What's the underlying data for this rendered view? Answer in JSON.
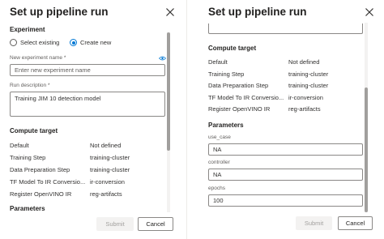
{
  "left": {
    "title": "Set up pipeline run",
    "experiment": {
      "heading": "Experiment",
      "options": [
        "Select existing",
        "Create new"
      ],
      "selected": "Create new",
      "name_label": "New experiment name *",
      "name_placeholder": "Enter new experiment name",
      "name_value": "",
      "desc_label": "Run description *",
      "desc_value": "Training JIM 10 detection model"
    },
    "compute": {
      "heading": "Compute target",
      "rows": [
        {
          "key": "Default",
          "value": "Not defined"
        },
        {
          "key": "Training Step",
          "value": "training-cluster"
        },
        {
          "key": "Data Preparation Step",
          "value": "training-cluster"
        },
        {
          "key": "TF Model To IR Conversio...",
          "value": "ir-conversion"
        },
        {
          "key": "Register OpenVINO IR",
          "value": "reg-artifacts"
        }
      ]
    },
    "parameters_heading": "Parameters",
    "submit_label": "Submit",
    "cancel_label": "Cancel"
  },
  "right": {
    "title": "Set up pipeline run",
    "compute": {
      "heading": "Compute target",
      "rows": [
        {
          "key": "Default",
          "value": "Not defined"
        },
        {
          "key": "Training Step",
          "value": "training-cluster"
        },
        {
          "key": "Data Preparation Step",
          "value": "training-cluster"
        },
        {
          "key": "TF Model To IR Conversio...",
          "value": "ir-conversion"
        },
        {
          "key": "Register OpenVINO IR",
          "value": "reg-artifacts"
        }
      ]
    },
    "parameters": {
      "heading": "Parameters",
      "fields": [
        {
          "label": "use_case",
          "value": "NA"
        },
        {
          "label": "controller",
          "value": "NA"
        },
        {
          "label": "epochs",
          "value": "100"
        }
      ]
    },
    "submit_label": "Submit",
    "cancel_label": "Cancel"
  },
  "colors": {
    "accent": "#0078d4",
    "border": "#8a8886",
    "scroll_thumb": "#a19f9d"
  }
}
